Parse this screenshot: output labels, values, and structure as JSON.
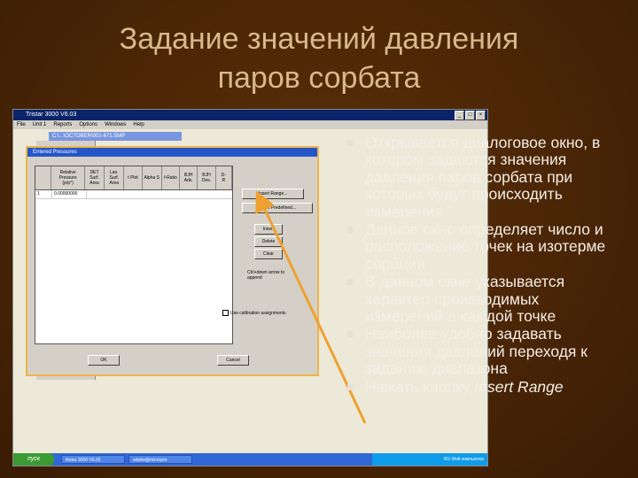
{
  "slide": {
    "title_line1": "Задание значений давления",
    "title_line2": "паров сорбата"
  },
  "app": {
    "title": "Tristar 3000 V6.03",
    "menu": [
      "File",
      "Unit 1",
      "Reports",
      "Options",
      "Windows",
      "Help"
    ],
    "subwindow_title": "C:\\...\\OCTOBER\\002-671.SMP"
  },
  "dialog": {
    "title": "Entered Pressures",
    "columns": [
      "Relative\nPressure\n(p/p°)",
      "DET\nSurf.\nArea",
      "Lan.\nSurf.\nArea",
      "t Plot",
      "Alpha S",
      "f-Ratio",
      "BJH\nAds.",
      "BJH\nDes.",
      "D-\nR"
    ],
    "rows": [
      [
        "1",
        "0.00000000",
        "",
        "",
        "",
        "",
        "",
        "",
        ""
      ]
    ],
    "buttons": {
      "insert_range": "Insert Range...",
      "insert_predefined": "Insert Predefined...",
      "insert": "Insert",
      "delete": "Delete",
      "clear": "Clear",
      "ok": "OK",
      "cancel": "Cancel"
    },
    "note": "Ctrl+down arrow to append",
    "calibration_label": "Use calibration assignments"
  },
  "taskbar": {
    "start": "пуск",
    "tasks": [
      "tristar 3000 V6.03",
      "adobe@micropor"
    ],
    "tray": "RU  Мой компьютер"
  },
  "bullets": [
    {
      "text": "Открывается диалоговое окно, в котором задаются значения давления паров сорбата при которых будут происходить измерения"
    },
    {
      "text": "Данное окно определяет число и расположение точек на изотерме сорбции"
    },
    {
      "text": "В данном окне указывается характер производимых измерений в каждой точке"
    },
    {
      "text": "Наиболее удобно задавать значения давлений переходя к заданию диапазона"
    },
    {
      "text": "Нажать кнопку ",
      "italic": "Insert Range"
    }
  ],
  "colors": {
    "background": "#4a2506",
    "title": "#d9b98a",
    "bullet_text": "#f4eee6",
    "arrow": "#f0a030",
    "dialog_border": "#f0b34a"
  }
}
